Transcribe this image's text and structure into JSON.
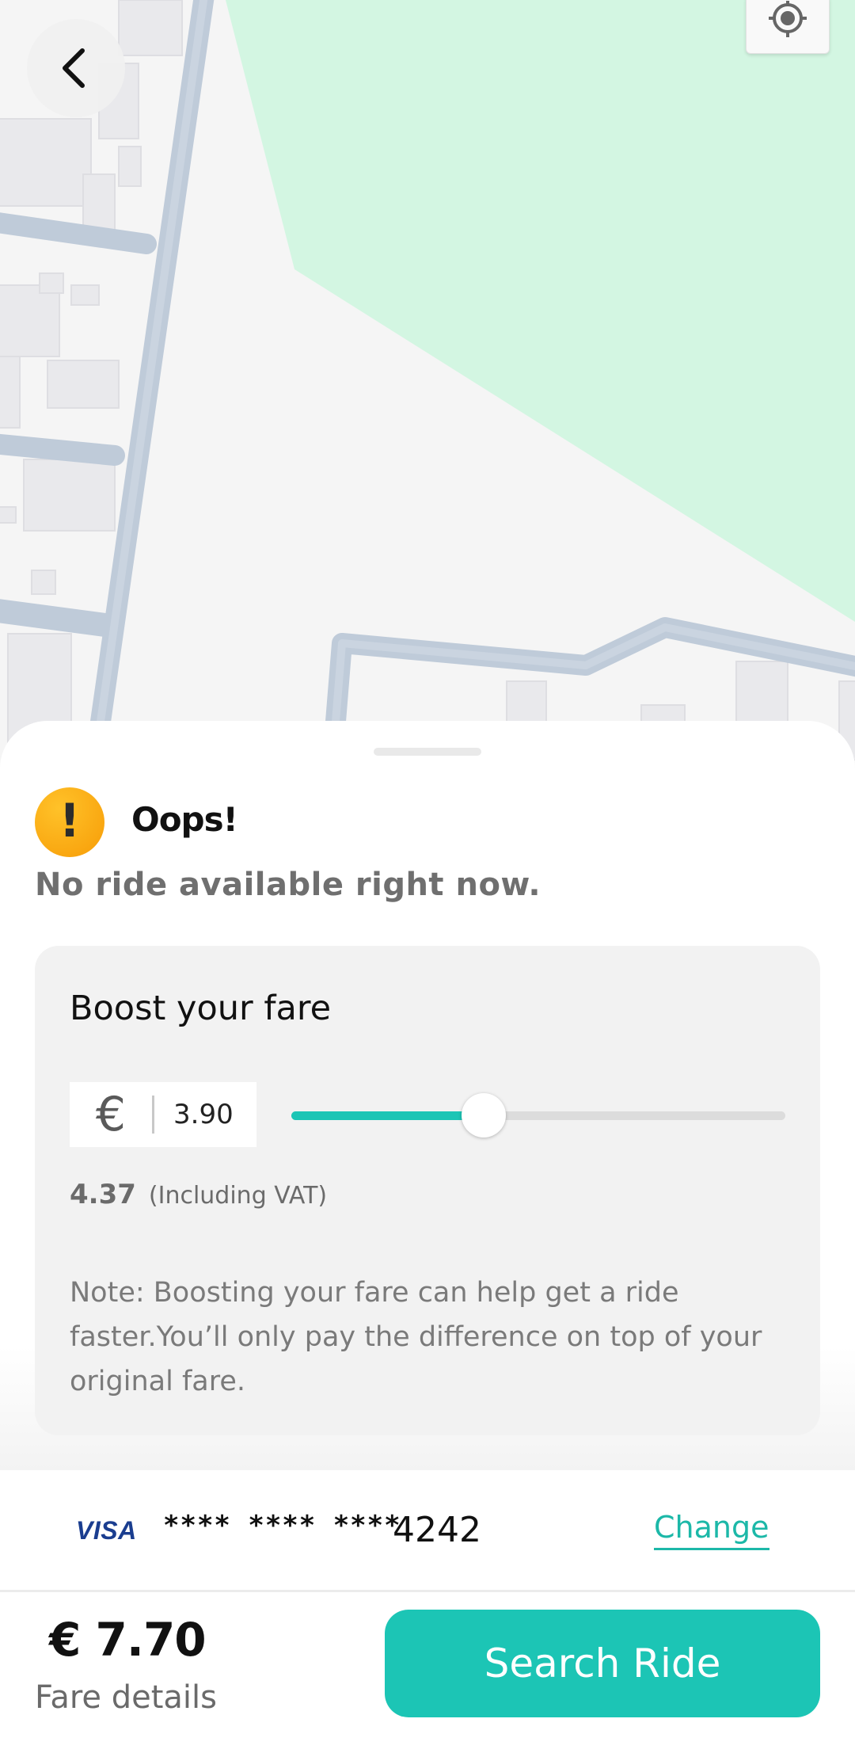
{
  "map": {
    "back_icon": "chevron-left-icon",
    "locate_icon": "my-location-icon",
    "colors": {
      "park": "#d3f6e2",
      "road": "#bfcbd9",
      "building": "#e9e9ec",
      "ground": "#f5f5f5"
    }
  },
  "alert": {
    "icon": "warning-icon",
    "mark": "!",
    "title": "Oops!",
    "message": "No ride available right now."
  },
  "boost": {
    "title": "Boost your fare",
    "currency_symbol": "€",
    "fare_value": "3.90",
    "slider_fraction": 0.39,
    "vat_amount": "4.37",
    "vat_label": "(Including VAT)",
    "note": "Note: Boosting your fare can help get a ride faster.You’ll only pay the difference on top of your original fare."
  },
  "payment": {
    "brand": "VISA",
    "masked": "**** **** ****",
    "last4": "4242",
    "change_label": "Change"
  },
  "footer": {
    "total": "€ 7.70",
    "fare_details_label": "Fare details",
    "search_label": "Search Ride"
  },
  "colors": {
    "accent": "#1cc5b5",
    "warning": "#f9a80e",
    "card_background": "#f2f2f2"
  }
}
